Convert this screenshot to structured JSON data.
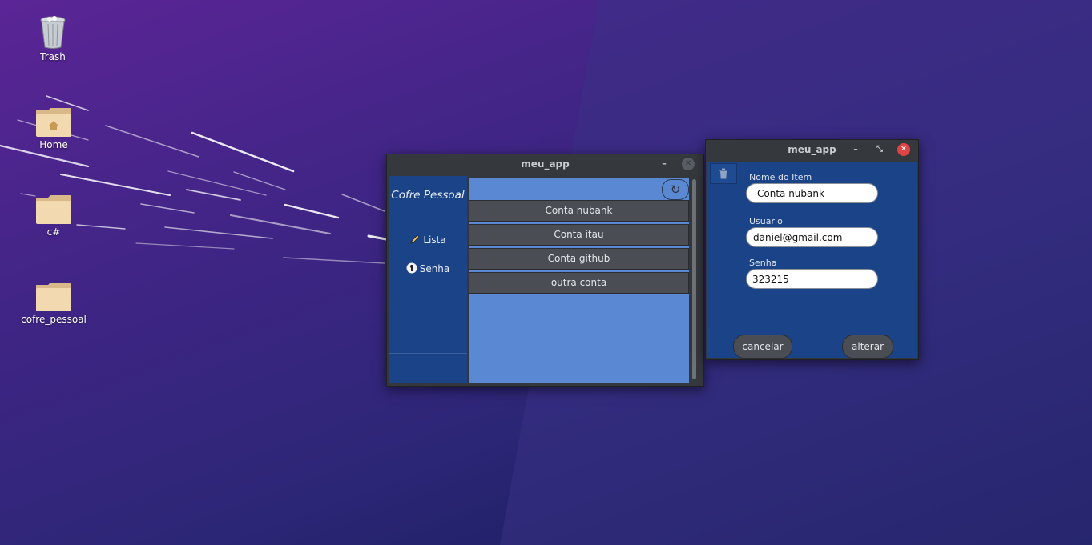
{
  "desktop": {
    "icons": [
      {
        "label": "Trash",
        "icon": "trash-icon"
      },
      {
        "label": "Home",
        "icon": "home-folder-icon"
      },
      {
        "label": "c#",
        "icon": "folder-icon"
      },
      {
        "label": "cofre_pessoal",
        "icon": "folder-icon"
      }
    ]
  },
  "main_window": {
    "title": "meu_app",
    "minimize_glyph": "–",
    "close_glyph": "✕",
    "sidebar": {
      "title": "Cofre Pessoal",
      "items": [
        {
          "label": "Lista",
          "icon": "pencil-icon"
        },
        {
          "label": "Senha",
          "icon": "key-icon"
        }
      ]
    },
    "refresh_glyph": "↻",
    "list_items": [
      "Conta nubank",
      "Conta itau",
      "Conta github",
      "outra conta"
    ]
  },
  "edit_window": {
    "title": "meu_app",
    "minimize_glyph": "–",
    "restore_glyph": "⤡",
    "close_glyph": "✕",
    "fields": [
      {
        "label": "Nome do Item",
        "value": "Conta nubank"
      },
      {
        "label": "Usuario",
        "value": "daniel@gmail.com"
      },
      {
        "label": "Senha",
        "value": "323215"
      }
    ],
    "cancel_label": "cancelar",
    "alter_label": "alterar"
  },
  "colors": {
    "panel_blue": "#1a4487",
    "list_blue": "#5b88d2",
    "button_gray": "#4a4d53",
    "titlebar": "#35383d",
    "close_red": "#e04545"
  }
}
